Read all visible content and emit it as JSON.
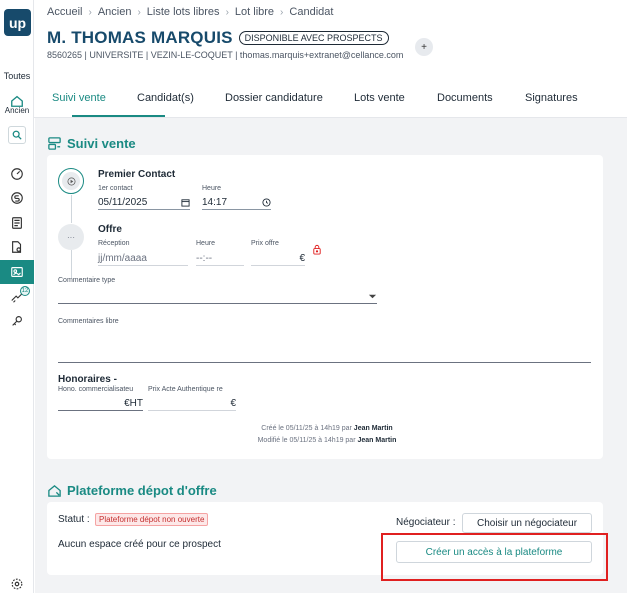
{
  "app": {
    "logo": "up"
  },
  "sidebar": {
    "toutes_label": "Toutes",
    "ancien_label": "Ancien",
    "badge": "12"
  },
  "breadcrumb": [
    "Accueil",
    "Ancien",
    "Liste lots libres",
    "Lot libre",
    "Candidat"
  ],
  "header": {
    "title": "M. THOMAS MARQUIS",
    "status": "DISPONIBLE AVEC PROSPECTS",
    "plus": "+",
    "subline": "8560265 | UNIVERSITE | VEZIN-LE-COQUET | thomas.marquis+extranet@cellance.com"
  },
  "tabs": [
    "Suivi vente",
    "Candidat(s)",
    "Dossier candidature",
    "Lots vente",
    "Documents",
    "Signatures"
  ],
  "suivi": {
    "title": "Suivi vente",
    "premier_contact": {
      "title": "Premier Contact",
      "date_label": "1er contact",
      "date_value": "05/11/2025",
      "time_label": "Heure",
      "time_value": "14:17"
    },
    "offre": {
      "title": "Offre",
      "reception_label": "Réception",
      "reception_placeholder": "jj/mm/aaaa",
      "heure_label": "Heure",
      "heure_placeholder": "--:--",
      "prix_label": "Prix offre",
      "prix_unit": "€",
      "step_dots": "···"
    },
    "commentaire_type_label": "Commentaire type",
    "commentaires_libre_label": "Commentaires libre",
    "honoraires": {
      "title": "Honoraires -",
      "hono_label": "Hono. commercialisateu",
      "hono_unit": "€HT",
      "prix_acte_label": "Prix Acte Authentique re",
      "prix_acte_unit": "€"
    },
    "created_text": "Créé le 05/11/25 à 14h19 par ",
    "created_by": "Jean Martin",
    "modified_text": "Modifié le 05/11/25 à 14h19 par ",
    "modified_by": "Jean Martin"
  },
  "plateforme": {
    "title": "Plateforme dépot d'offre",
    "statut_label": "Statut :",
    "statut_value": "Plateforme dépot non ouverte",
    "empty_text": "Aucun espace créé pour ce prospect",
    "negociateur_label": "Négociateur :",
    "choose_button": "Choisir un négociateur",
    "create_button": "Créer un accès à la plateforme"
  },
  "colors": {
    "brand": "#174a6b",
    "accent": "#1a8a83",
    "danger": "#e02020"
  }
}
